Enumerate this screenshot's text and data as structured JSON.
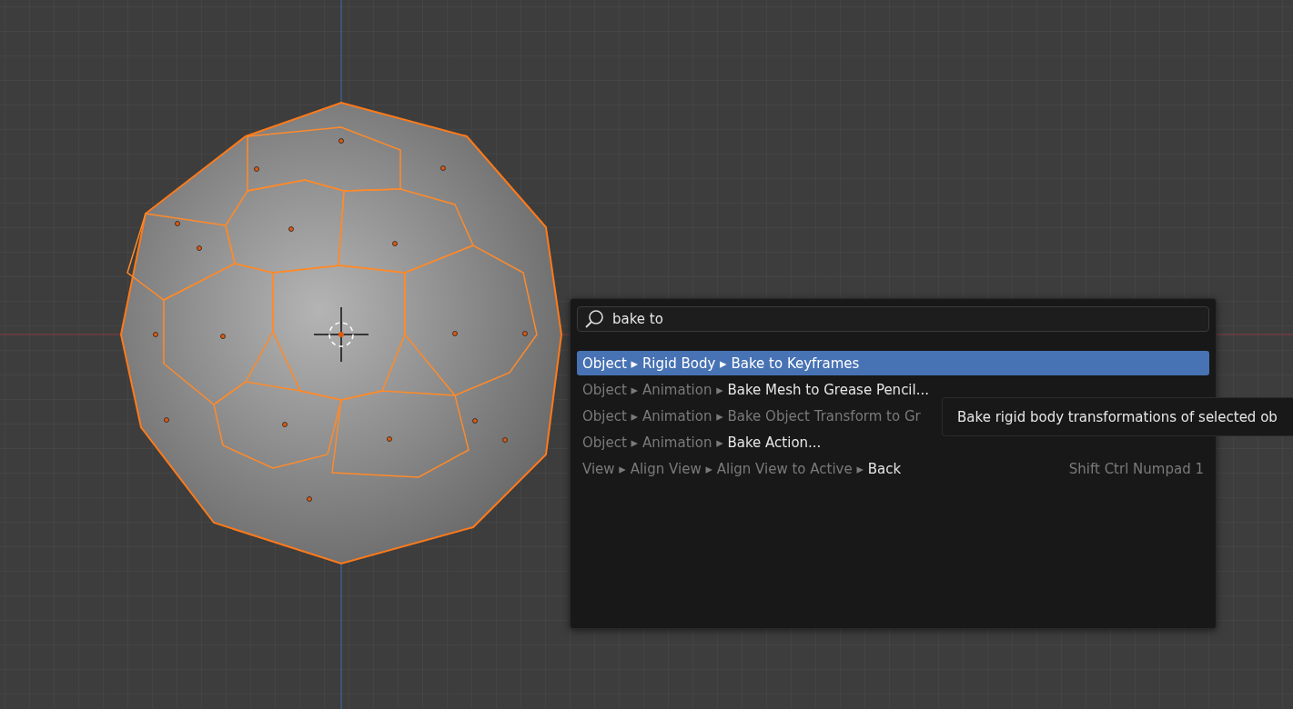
{
  "search_menu": {
    "query": "bake to",
    "results": [
      {
        "path": "Object ▸ Rigid Body ▸",
        "name": "Bake to Keyframes",
        "selected": true,
        "disabled": false
      },
      {
        "path": "Object ▸ Animation ▸",
        "name": "Bake Mesh to Grease Pencil...",
        "selected": false,
        "disabled": false
      },
      {
        "path": "Object ▸ Animation ▸",
        "name": "Bake Object Transform to Gr",
        "selected": false,
        "disabled": true
      },
      {
        "path": "Object ▸ Animation ▸",
        "name": "Bake Action...",
        "selected": false,
        "disabled": false
      },
      {
        "path": "View ▸ Align View ▸ Align View to Active ▸",
        "name": "Back",
        "shortcut": "Shift Ctrl Numpad 1",
        "selected": false,
        "disabled": false
      }
    ]
  },
  "tooltip": {
    "text": "Bake rigid body transformations of selected ob"
  }
}
